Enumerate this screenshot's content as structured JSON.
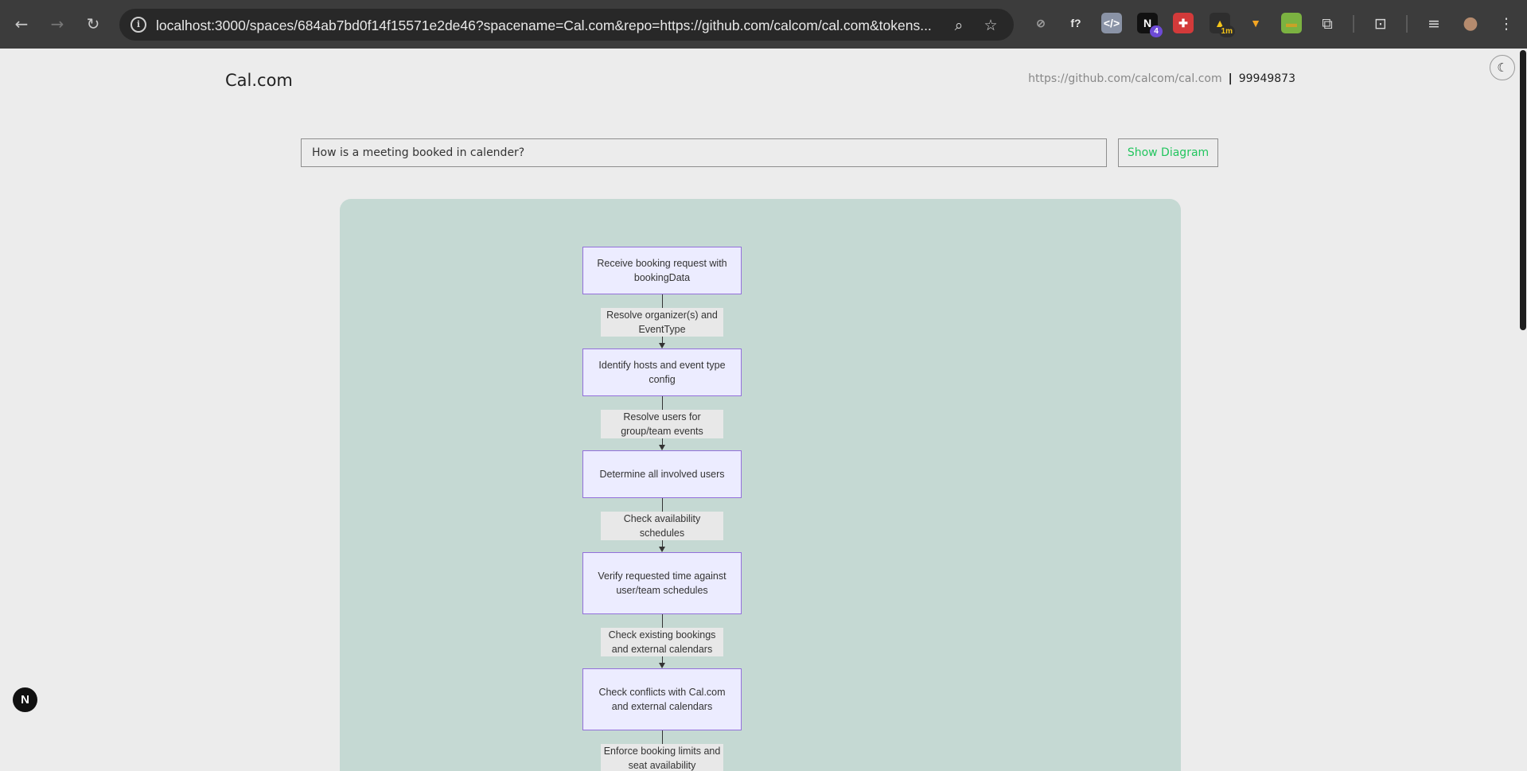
{
  "browser": {
    "url": "localhost:3000/spaces/684ab7bd0f14f15571e2de46?spacename=Cal.com&repo=https://github.com/calcom/cal.com&tokens...",
    "icons": {
      "back": "←",
      "forward": "→",
      "reload": "↻",
      "info": "i",
      "zoom": "⌕",
      "star": "☆",
      "menu": "⋮",
      "extensions": "⧉",
      "capture": "⊡",
      "media": "≡",
      "profile": "●"
    },
    "extensions": [
      {
        "name": "blocked-extension",
        "glyph": "⊘",
        "bg": "#3c3c3c",
        "color": "#9a9a9a"
      },
      {
        "name": "formula-extension",
        "glyph": "f?",
        "bg": "#3c3c3c",
        "color": "#e8e8e8"
      },
      {
        "name": "code-extension",
        "glyph": "</>",
        "bg": "#8a93a6",
        "color": "#ffffff"
      },
      {
        "name": "n-extension",
        "glyph": "N",
        "bg": "#111111",
        "color": "#ffffff",
        "badge": "4",
        "badge_bg": "#6d4ad6"
      },
      {
        "name": "puzzle-red-extension",
        "glyph": "✚",
        "bg": "#d33a3a",
        "color": "#ffffff"
      },
      {
        "name": "timer-extension",
        "glyph": "▲",
        "bg": "#2e2e2e",
        "color": "#f5c518",
        "badge": "1m",
        "badge_bg": "#2e2e2e"
      },
      {
        "name": "triangle-extension",
        "glyph": "▼",
        "bg": "#3c3c3c",
        "color": "#f5a623"
      },
      {
        "name": "green-extension",
        "glyph": "▬",
        "bg": "#7bb241",
        "color": "#c9a227"
      }
    ]
  },
  "header": {
    "brand": "Cal.com",
    "repo_url": "https://github.com/calcom/cal.com",
    "divider": "|",
    "tokens": "99949873",
    "theme_icon": "☾"
  },
  "search": {
    "query": "How is a meeting booked in calender?",
    "button_label": "Show Diagram"
  },
  "diagram": {
    "nodes": [
      "Receive booking request with bookingData",
      "Identify hosts and event type config",
      "Determine all involved users",
      "Verify requested time against user/team schedules",
      "Check conflicts with Cal.com and external calendars"
    ],
    "edges": [
      "Resolve organizer(s) and EventType",
      "Resolve users for group/team events",
      "Check availability schedules",
      "Check existing bookings and external calendars",
      "Enforce booking limits and seat availability"
    ]
  },
  "dev_badge": "N",
  "colors": {
    "node_fill": "#ececff",
    "node_border": "#9370db",
    "panel_bg": "#c5d9d3",
    "button_text": "#22c55e"
  }
}
